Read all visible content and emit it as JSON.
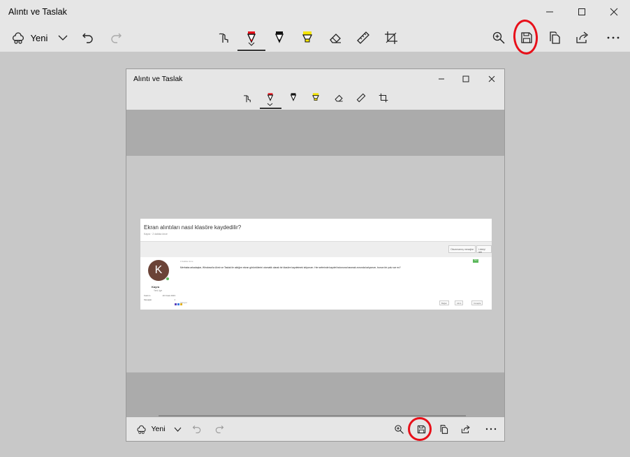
{
  "window": {
    "title": "Alıntı ve Taslak"
  },
  "toolbar": {
    "new_label": "Yeni"
  },
  "inner": {
    "title": "Alıntı ve Taslak",
    "new_label": "Yeni",
    "forum": {
      "question_title": "Ekran alıntıları nasıl klasöre kaydedilir?",
      "question_meta": "Kayra · 2 dakika önce",
      "btn_unread": "Okunmamış mesajlar",
      "btn_reply": "Listeyi izle",
      "avatar_letter": "K",
      "user_name": "Kayra",
      "user_role": "Yeni üye",
      "stats": [
        {
          "k": "Katılım",
          "v": "19 Ocak 2023"
        },
        {
          "k": "Mesajlar",
          "v": "1"
        }
      ],
      "post_date": "2 dakika önce",
      "post_text": "Merhaba arkadaşlar, Windows'ta Alıntı ve Taslak ile aldığım ekran görüntülerini otomatik olarak bir klasöre kaydetmek istiyorum. Her seferinde kaydet butonuna basmak zorunda kalıyorum, bunun bir yolu var mı?",
      "new_badge": "Yeni",
      "report": "Şikayet",
      "actions": [
        "Beğen",
        "Alıntı",
        "Cevapla"
      ]
    }
  },
  "colors": {
    "accent_red": "#e8101a",
    "highlighter": "#f4e500",
    "chrome": "#e6e6e6",
    "canvas": "#c8c8c8"
  }
}
